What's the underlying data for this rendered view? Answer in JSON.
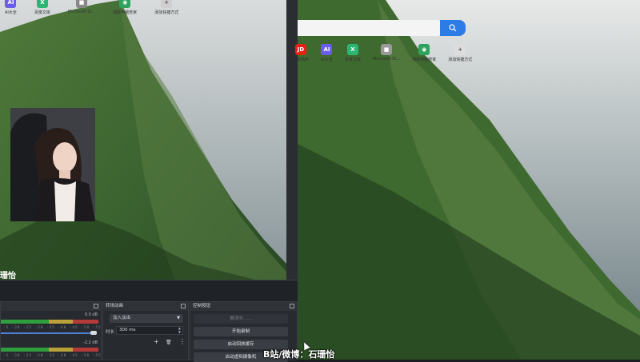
{
  "left_shortcuts": [
    {
      "label": "AI大全",
      "glyph": "AI",
      "color": "#6a5cf0"
    },
    {
      "label": "百度文库",
      "glyph": "X",
      "color": "#2bb673"
    },
    {
      "label": "Microsoft St...",
      "glyph": "■",
      "color": "#888888"
    },
    {
      "label": "骑联电脑管家",
      "glyph": "◉",
      "color": "#2fa35d"
    },
    {
      "label": "添加快捷方式",
      "glyph": "+",
      "color": "#cfcfcf"
    }
  ],
  "right_shortcuts": [
    {
      "label": "京东热卖",
      "glyph": "JD",
      "color": "#e2231a"
    },
    {
      "label": "AI大全",
      "glyph": "AI",
      "color": "#6a5cf0"
    },
    {
      "label": "百度文库",
      "glyph": "X",
      "color": "#2bb673"
    },
    {
      "label": "Microsoft St...",
      "glyph": "■",
      "color": "#999999"
    },
    {
      "label": "骑联电脑管家",
      "glyph": "◉",
      "color": "#2fa35d"
    },
    {
      "label": "添加快捷方式",
      "glyph": "+",
      "color": "#dddddd"
    }
  ],
  "streamer_name": "珊怡",
  "obs": {
    "mixer": {
      "track1_db": "0.0 dB",
      "track2_db": "-2.2 dB",
      "ticks": "-5 -20 -25 -30 -35 -40 -45 -50 -55 -60"
    },
    "transitions": {
      "title": "转场动画",
      "selected": "淡入淡出",
      "duration_label": "时长",
      "duration_value": "300 ms",
      "add_glyph": "+",
      "delete_glyph": "🗑",
      "more_glyph": "⋮"
    },
    "controls": {
      "title": "控制按钮",
      "streaming": "推流中……",
      "start_recording": "开始录制",
      "start_replay": "启动回放缓存",
      "start_virtual_cam": "启动虚拟摄像机"
    }
  },
  "caption": "B站/微博：石珊怡",
  "colors": {
    "accent_blue": "#2d7be5",
    "meter_green": "#2f9e3f",
    "meter_yellow": "#b9a23a",
    "meter_red": "#b53a3a"
  }
}
